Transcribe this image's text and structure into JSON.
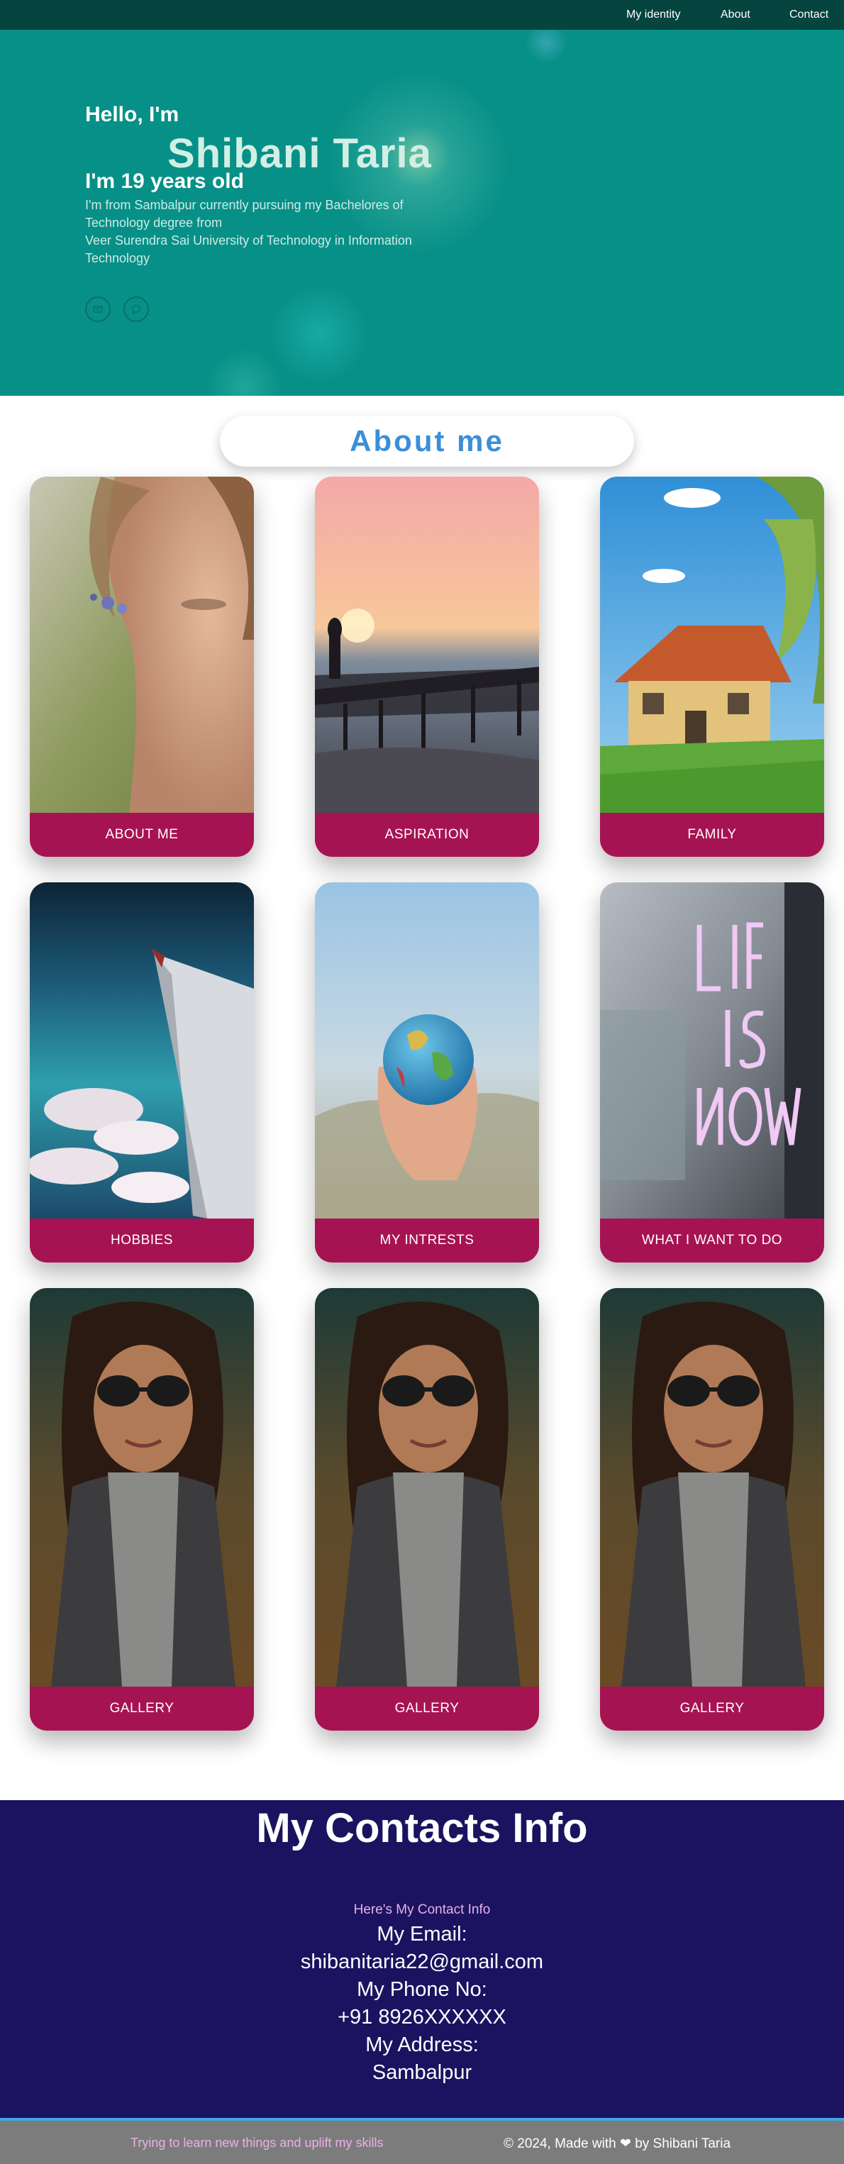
{
  "nav": {
    "items": [
      {
        "label": "My identity"
      },
      {
        "label": "About"
      },
      {
        "label": "Contact"
      }
    ]
  },
  "hero": {
    "greeting": "Hello, I'm",
    "name": "Shibani Taria",
    "age": "I'm 19 years old",
    "bio_lines": [
      "I'm from Sambalpur currently pursuing my Bachelores of",
      "Technology degree from",
      "Veer Surendra Sai University of Technology in Information",
      "Technology"
    ],
    "socials": [
      {
        "icon": "mail-icon"
      },
      {
        "icon": "chat-icon"
      }
    ]
  },
  "about": {
    "title": "About me"
  },
  "cards": [
    {
      "label": "ABOUT ME"
    },
    {
      "label": "ASPIRATION"
    },
    {
      "label": "FAMILY"
    },
    {
      "label": "HOBBIES"
    },
    {
      "label": "MY INTRESTS"
    },
    {
      "label": "WHAT I WANT TO DO"
    },
    {
      "label": "GALLERY"
    },
    {
      "label": "GALLERY"
    },
    {
      "label": "GALLERY"
    }
  ],
  "contact": {
    "title": "My Contacts Info",
    "subtitle": "Here's My Contact Info",
    "email_label": "My Email:",
    "email": "shibanitaria22@gmail.com",
    "phone_label": "My Phone No:",
    "phone": "+91 8926XXXXXX",
    "address_label": "My Address:",
    "address": "Sambalpur"
  },
  "footer": {
    "tagline": "Trying to learn new things and uplift my skills",
    "credit_prefix": "© 2024, Made with",
    "credit_suffix": "by Shibani Taria"
  },
  "colors": {
    "nav_bg": "#05443f",
    "hero_bg": "#079087",
    "accent_blue": "#3a8fd8",
    "card_label_bg": "#a61352",
    "contact_bg": "#1b1360",
    "footer_bg": "#7c7c7c",
    "footer_border": "#3ea5e6",
    "pink_text": "#e8b0e9"
  }
}
